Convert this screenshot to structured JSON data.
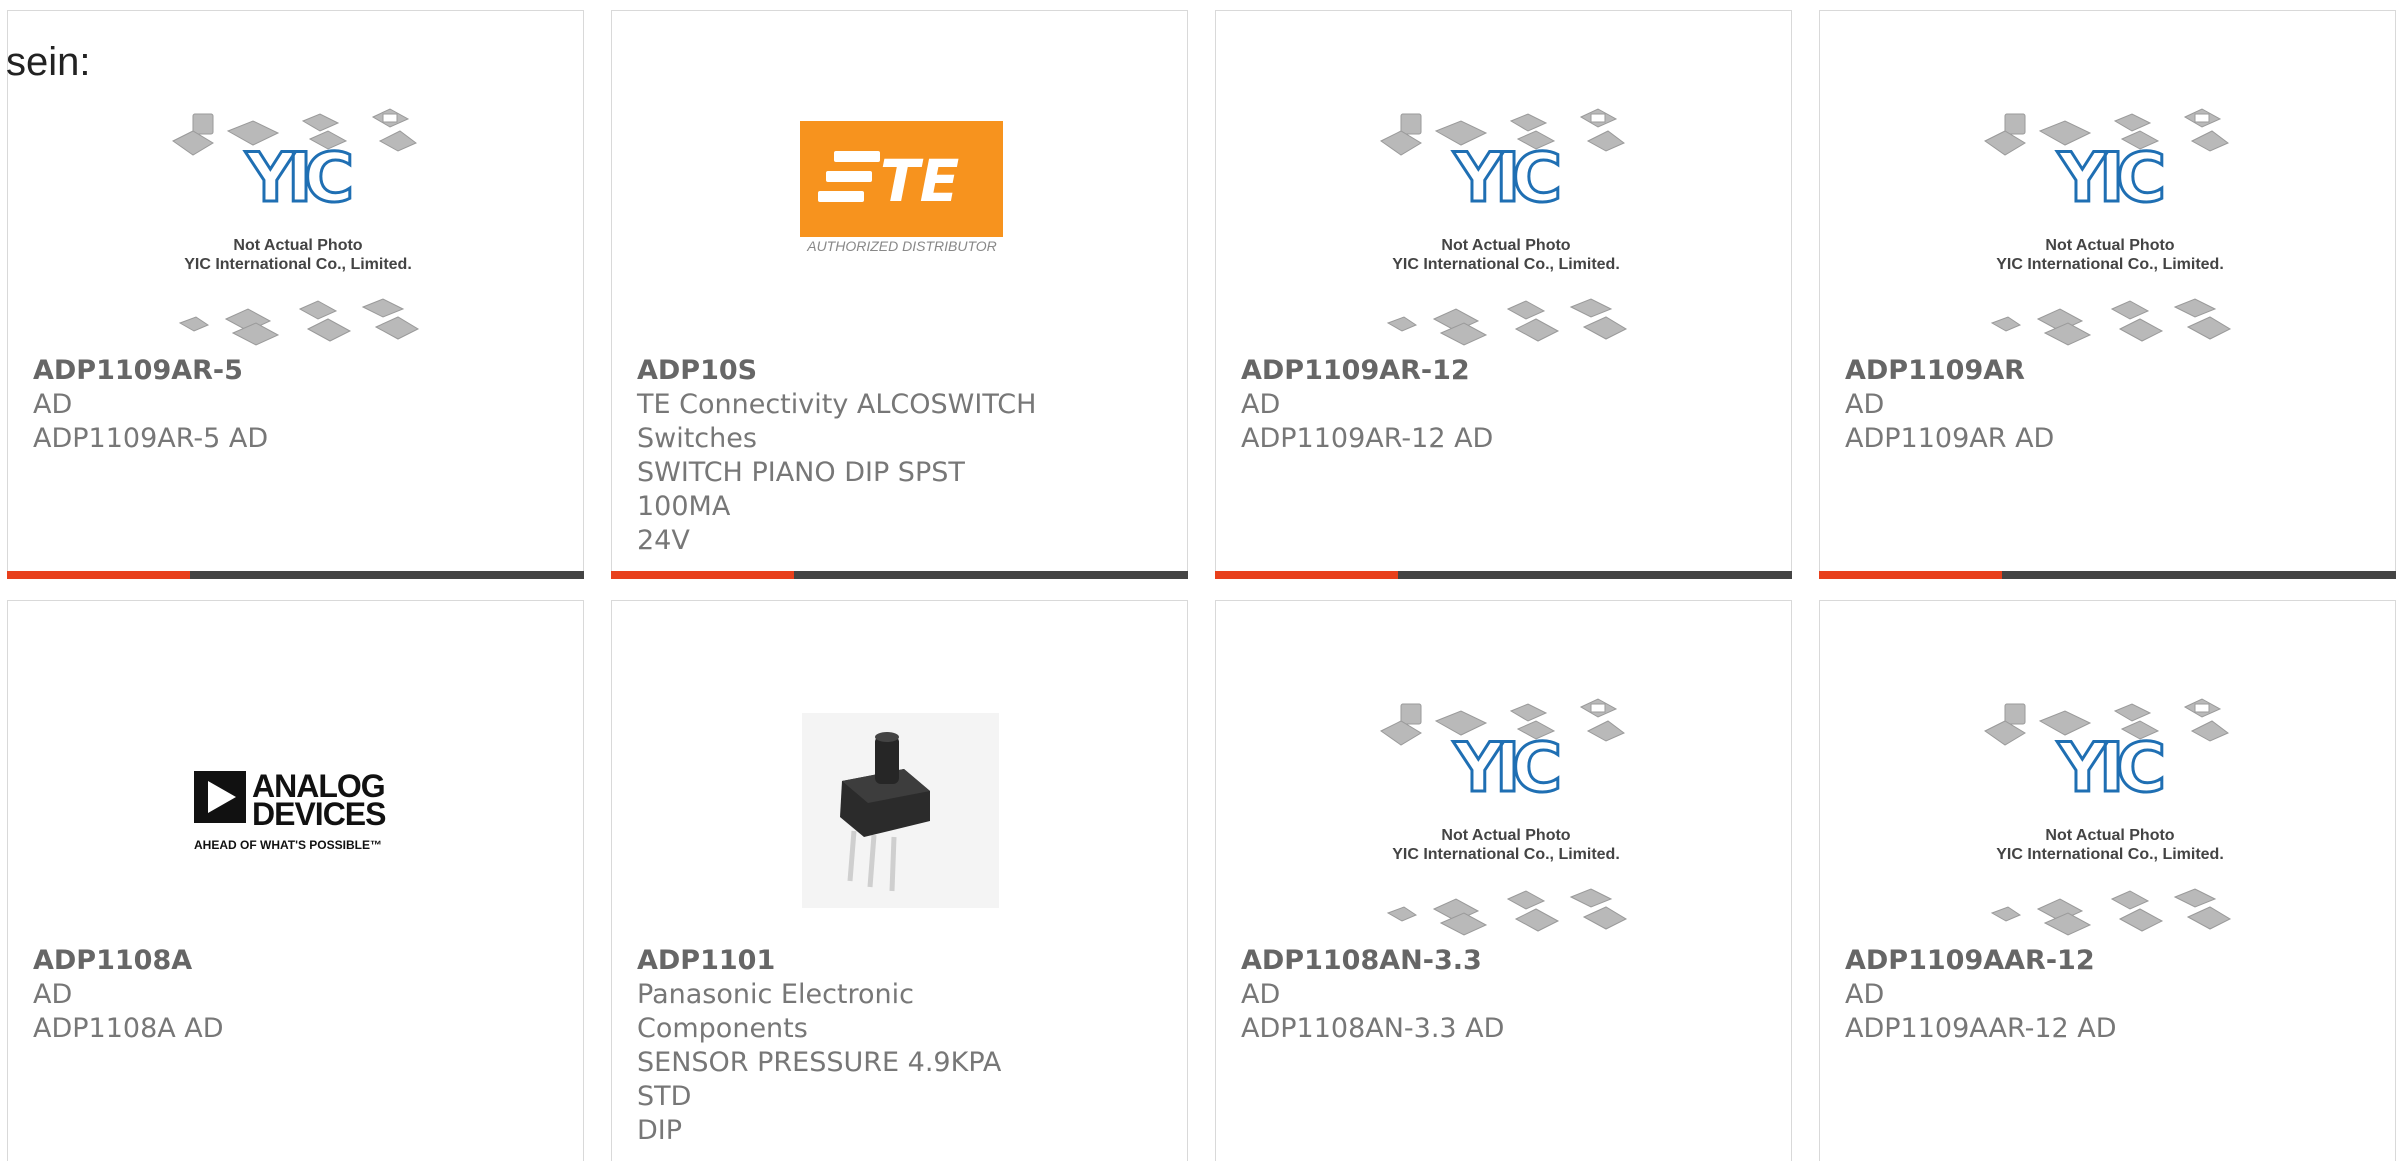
{
  "fragment_text": "sein:",
  "accent_color": "#e8401c",
  "bar_color": "#444444",
  "placeholder": {
    "line1": "Not Actual Photo",
    "line2": "YIC International Co., Limited.",
    "logo": "YIC"
  },
  "te_logo": {
    "caption": "AUTHORIZED DISTRIBUTOR",
    "color": "#f7931e"
  },
  "adi_logo": {
    "line1": "ANALOG",
    "line2": "DEVICES",
    "tagline": "AHEAD OF WHAT'S POSSIBLE™"
  },
  "products": [
    {
      "part": "ADP1109AR-5",
      "lines": [
        "AD",
        "ADP1109AR-5 AD"
      ],
      "image": "yic-placeholder"
    },
    {
      "part": "ADP10S",
      "lines": [
        "TE Connectivity ALCOSWITCH",
        "Switches",
        "SWITCH PIANO DIP SPST 100MA",
        "24V"
      ],
      "image": "te-connectivity-logo"
    },
    {
      "part": "ADP1109AR-12",
      "lines": [
        "AD",
        "ADP1109AR-12 AD"
      ],
      "image": "yic-placeholder"
    },
    {
      "part": "ADP1109AR",
      "lines": [
        "AD",
        "ADP1109AR AD"
      ],
      "image": "yic-placeholder"
    },
    {
      "part": "ADP1108A",
      "lines": [
        "AD",
        "ADP1108A AD"
      ],
      "image": "analog-devices-logo"
    },
    {
      "part": "ADP1101",
      "lines": [
        "Panasonic Electronic Components",
        "SENSOR PRESSURE 4.9KPA STD",
        "DIP"
      ],
      "image": "pressure-sensor-photo"
    },
    {
      "part": "ADP1108AN-3.3",
      "lines": [
        "AD",
        "ADP1108AN-3.3 AD"
      ],
      "image": "yic-placeholder"
    },
    {
      "part": "ADP1109AAR-12",
      "lines": [
        "AD",
        "ADP1109AAR-12 AD"
      ],
      "image": "yic-placeholder"
    }
  ]
}
